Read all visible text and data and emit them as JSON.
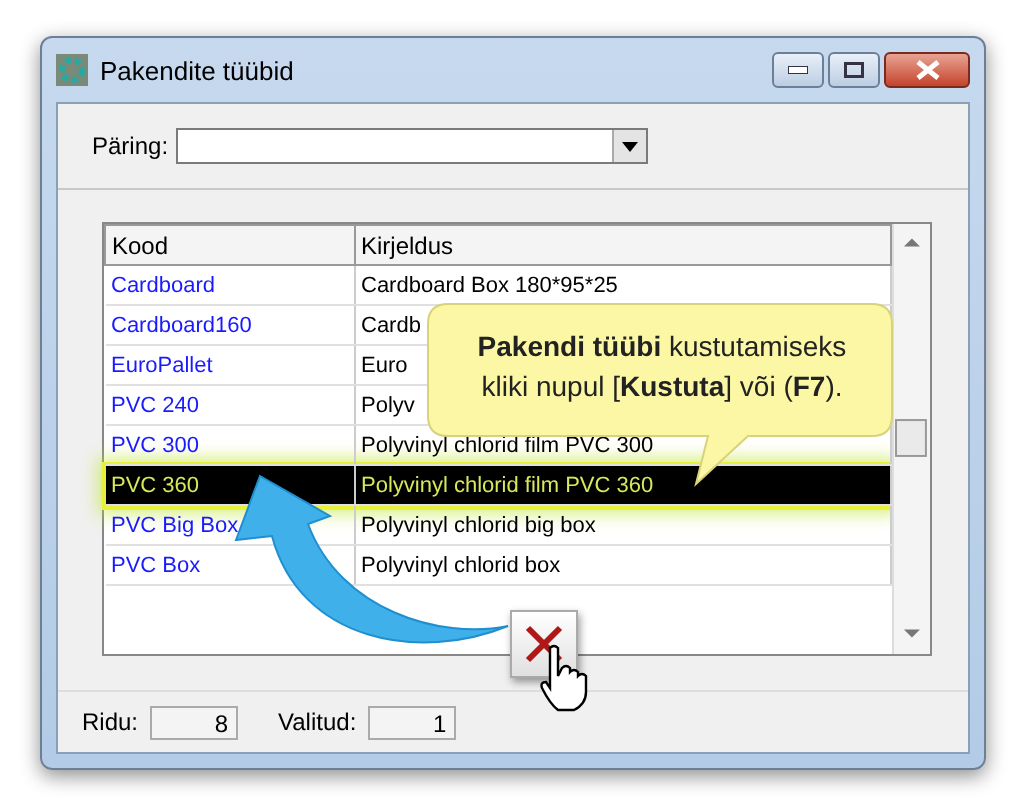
{
  "window": {
    "title": "Pakendite tüübid"
  },
  "query": {
    "label": "Päring:"
  },
  "table": {
    "columns": [
      "Kood",
      "Kirjeldus"
    ],
    "rows": [
      {
        "code": "Cardboard",
        "description": "Cardboard Box 180*95*25",
        "selected": false
      },
      {
        "code": "Cardboard160",
        "description": "Cardb",
        "selected": false
      },
      {
        "code": "EuroPallet",
        "description": "Euro",
        "selected": false
      },
      {
        "code": "PVC 240",
        "description": "Polyv",
        "selected": false
      },
      {
        "code": "PVC 300",
        "description": "Polyvinyl chlorid film PVC 300",
        "selected": false
      },
      {
        "code": "PVC 360",
        "description": "Polyvinyl chlorid film PVC 360",
        "selected": true
      },
      {
        "code": "PVC Big Box",
        "description": "Polyvinyl chlorid big box",
        "selected": false
      },
      {
        "code": "PVC Box",
        "description": "Polyvinyl chlorid box",
        "selected": false
      }
    ]
  },
  "callout": {
    "text": "**Pakendi tüübi** kustutamiseks kliki nupul [**Kustuta**] või (**F7**)."
  },
  "status_bar": {
    "rows_label": "Ridu:",
    "rows_value": "8",
    "selected_label": "Valitud:",
    "selected_value": "1"
  }
}
